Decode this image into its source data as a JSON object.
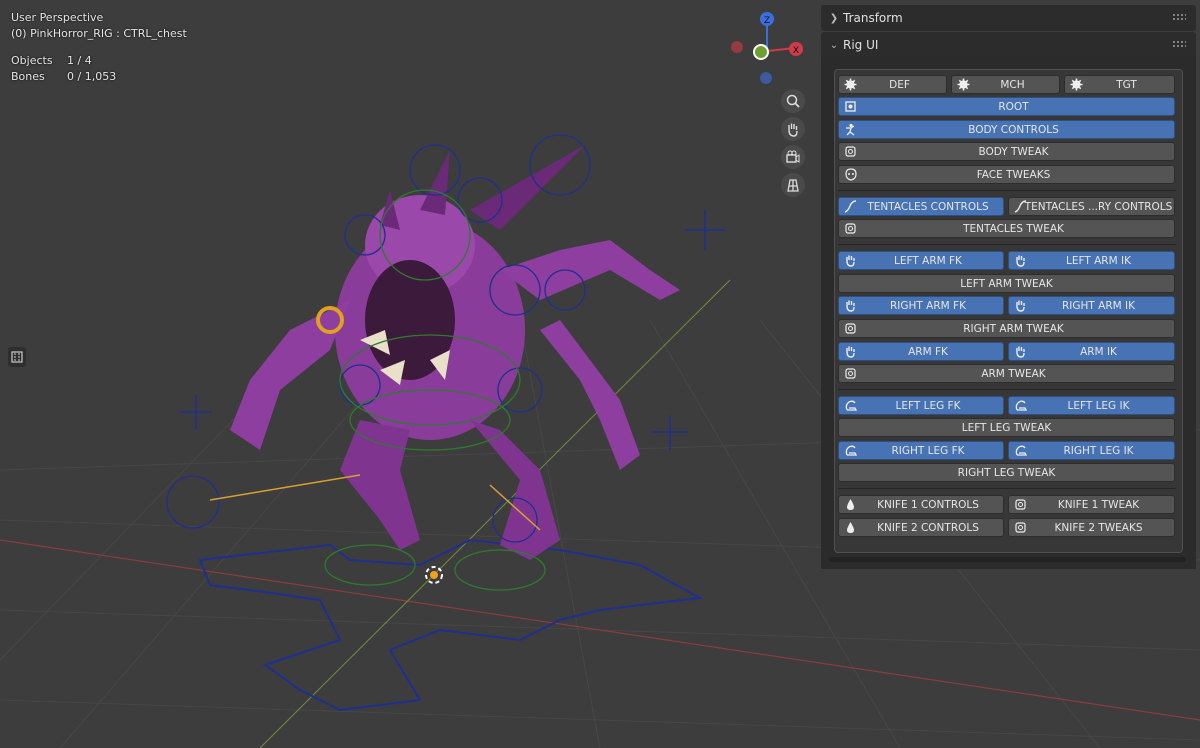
{
  "viewport": {
    "title": "User Perspective",
    "object": "(0) PinkHorror_RIG : CTRL_chest",
    "stats": [
      {
        "key": "Objects",
        "value": "1 / 4"
      },
      {
        "key": "Bones",
        "value": "0 / 1,053"
      }
    ],
    "gizmo": {
      "z": "Z",
      "x": "X",
      "y": "Y"
    },
    "nav_icons": [
      "zoom-icon",
      "hand-pan-icon",
      "camera-icon",
      "grid-icon"
    ]
  },
  "colors": {
    "accent": "#4772b3",
    "button": "#545454",
    "panel": "#2b2b2b",
    "viewport": "#3d3d3d"
  },
  "sidebar": {
    "transform_label": "Transform",
    "rig_ui_label": "Rig UI",
    "buttons": {
      "def": "DEF",
      "mch": "MCH",
      "tgt": "TGT",
      "root": "ROOT",
      "body_controls": "BODY CONTROLS",
      "body_tweak": "BODY TWEAK",
      "face_tweaks": "FACE TWEAKS",
      "tentacles_controls": "TENTACLES CONTROLS",
      "tentacles_ry_controls": "TENTACLES ...RY CONTROLS",
      "tentacles_tweak": "TENTACLES TWEAK",
      "left_arm_fk": "LEFT ARM FK",
      "left_arm_ik": "LEFT ARM IK",
      "left_arm_tweak": "LEFT ARM TWEAK",
      "right_arm_fk": "RIGHT ARM FK",
      "right_arm_ik": "RIGHT ARM IK",
      "right_arm_tweak": "RIGHT ARM TWEAK",
      "arm_fk": "ARM FK",
      "arm_ik": "ARM IK",
      "arm_tweak": "ARM TWEAK",
      "left_leg_fk": "LEFT LEG FK",
      "left_leg_ik": "LEFT LEG IK",
      "left_leg_tweak": "LEFT LEG TWEAK",
      "right_leg_fk": "RIGHT LEG FK",
      "right_leg_ik": "RIGHT LEG IK",
      "right_leg_tweak": "RIGHT LEG TWEAK",
      "knife1_controls": "KNIFE 1 CONTROLS",
      "knife1_tweak": "KNIFE 1 TWEAK",
      "knife2_controls": "KNIFE 2 CONTROLS",
      "knife2_tweaks": "KNIFE 2 TWEAKS"
    }
  }
}
